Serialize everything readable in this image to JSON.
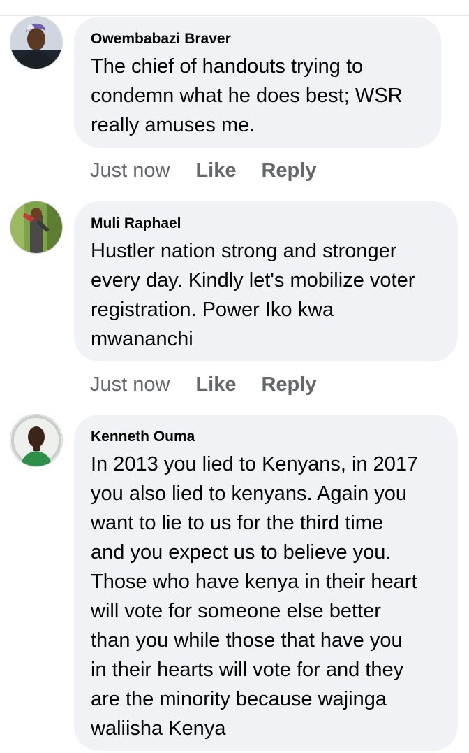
{
  "comments": [
    {
      "author": "Owembabazi Braver",
      "text": "The chief of handouts trying to\ncondemn what he does best; WSR\nreally amuses me.",
      "time": "Just now",
      "like_label": "Like",
      "reply_label": "Reply"
    },
    {
      "author": "Muli Raphael",
      "text": "Hustler nation strong and stronger\nevery day. Kindly let's mobilize voter\nregistration. Power Iko kwa\nmwananchi",
      "time": "Just now",
      "like_label": "Like",
      "reply_label": "Reply"
    },
    {
      "author": "Kenneth Ouma",
      "text": "In 2013 you lied to Kenyans, in 2017\nyou also lied to kenyans. Again you\nwant to lie to us for the third time\nand you expect us to believe you.\nThose who have kenya in their heart\nwill vote for someone else better\nthan you while those that have you\nin their hearts will vote for and they\nare the minority because wajinga\nwaliisha Kenya"
    }
  ],
  "colors": {
    "bubble": "#f0f2f5",
    "meta_text": "#65676b",
    "body_text": "#050505"
  }
}
